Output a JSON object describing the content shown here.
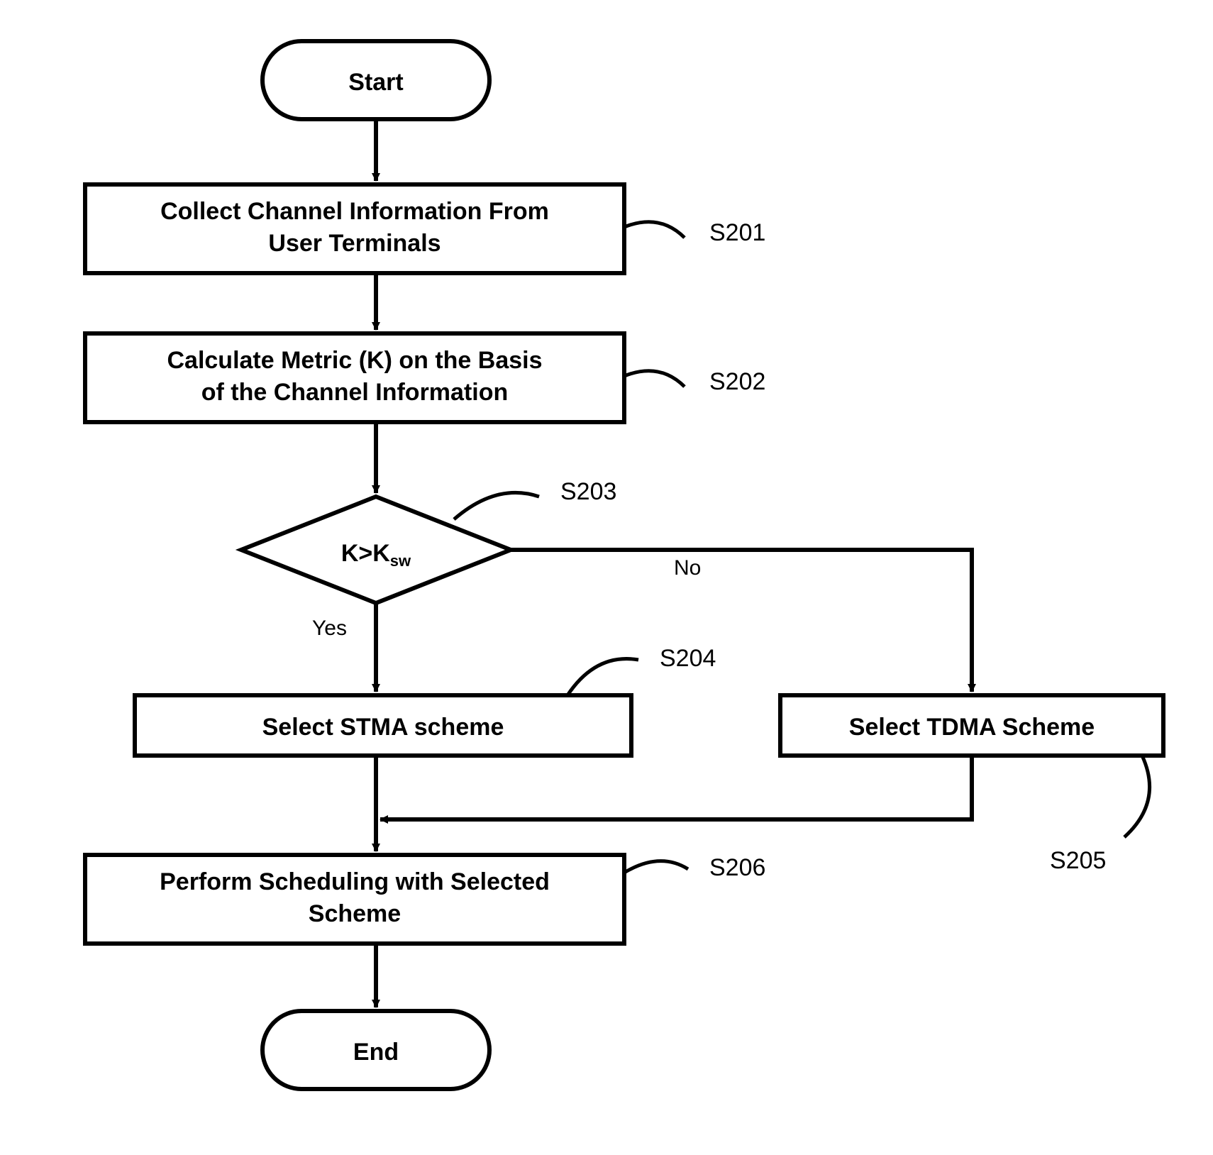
{
  "start": "Start",
  "end": "End",
  "steps": {
    "s201": {
      "line1": "Collect Channel Information From",
      "line2": "User Terminals",
      "label": "S201"
    },
    "s202": {
      "line1": "Calculate Metric (K) on the Basis",
      "line2": "of the Channel Information",
      "label": "S202"
    },
    "s203": {
      "text_k": "K>K",
      "text_sub": "sw",
      "label": "S203",
      "yes": "Yes",
      "no": "No"
    },
    "s204": {
      "line1": "Select STMA scheme",
      "label": "S204"
    },
    "s205": {
      "line1": "Select TDMA Scheme",
      "label": "S205"
    },
    "s206": {
      "line1": "Perform Scheduling with Selected",
      "line2": "Scheme",
      "label": "S206"
    }
  }
}
